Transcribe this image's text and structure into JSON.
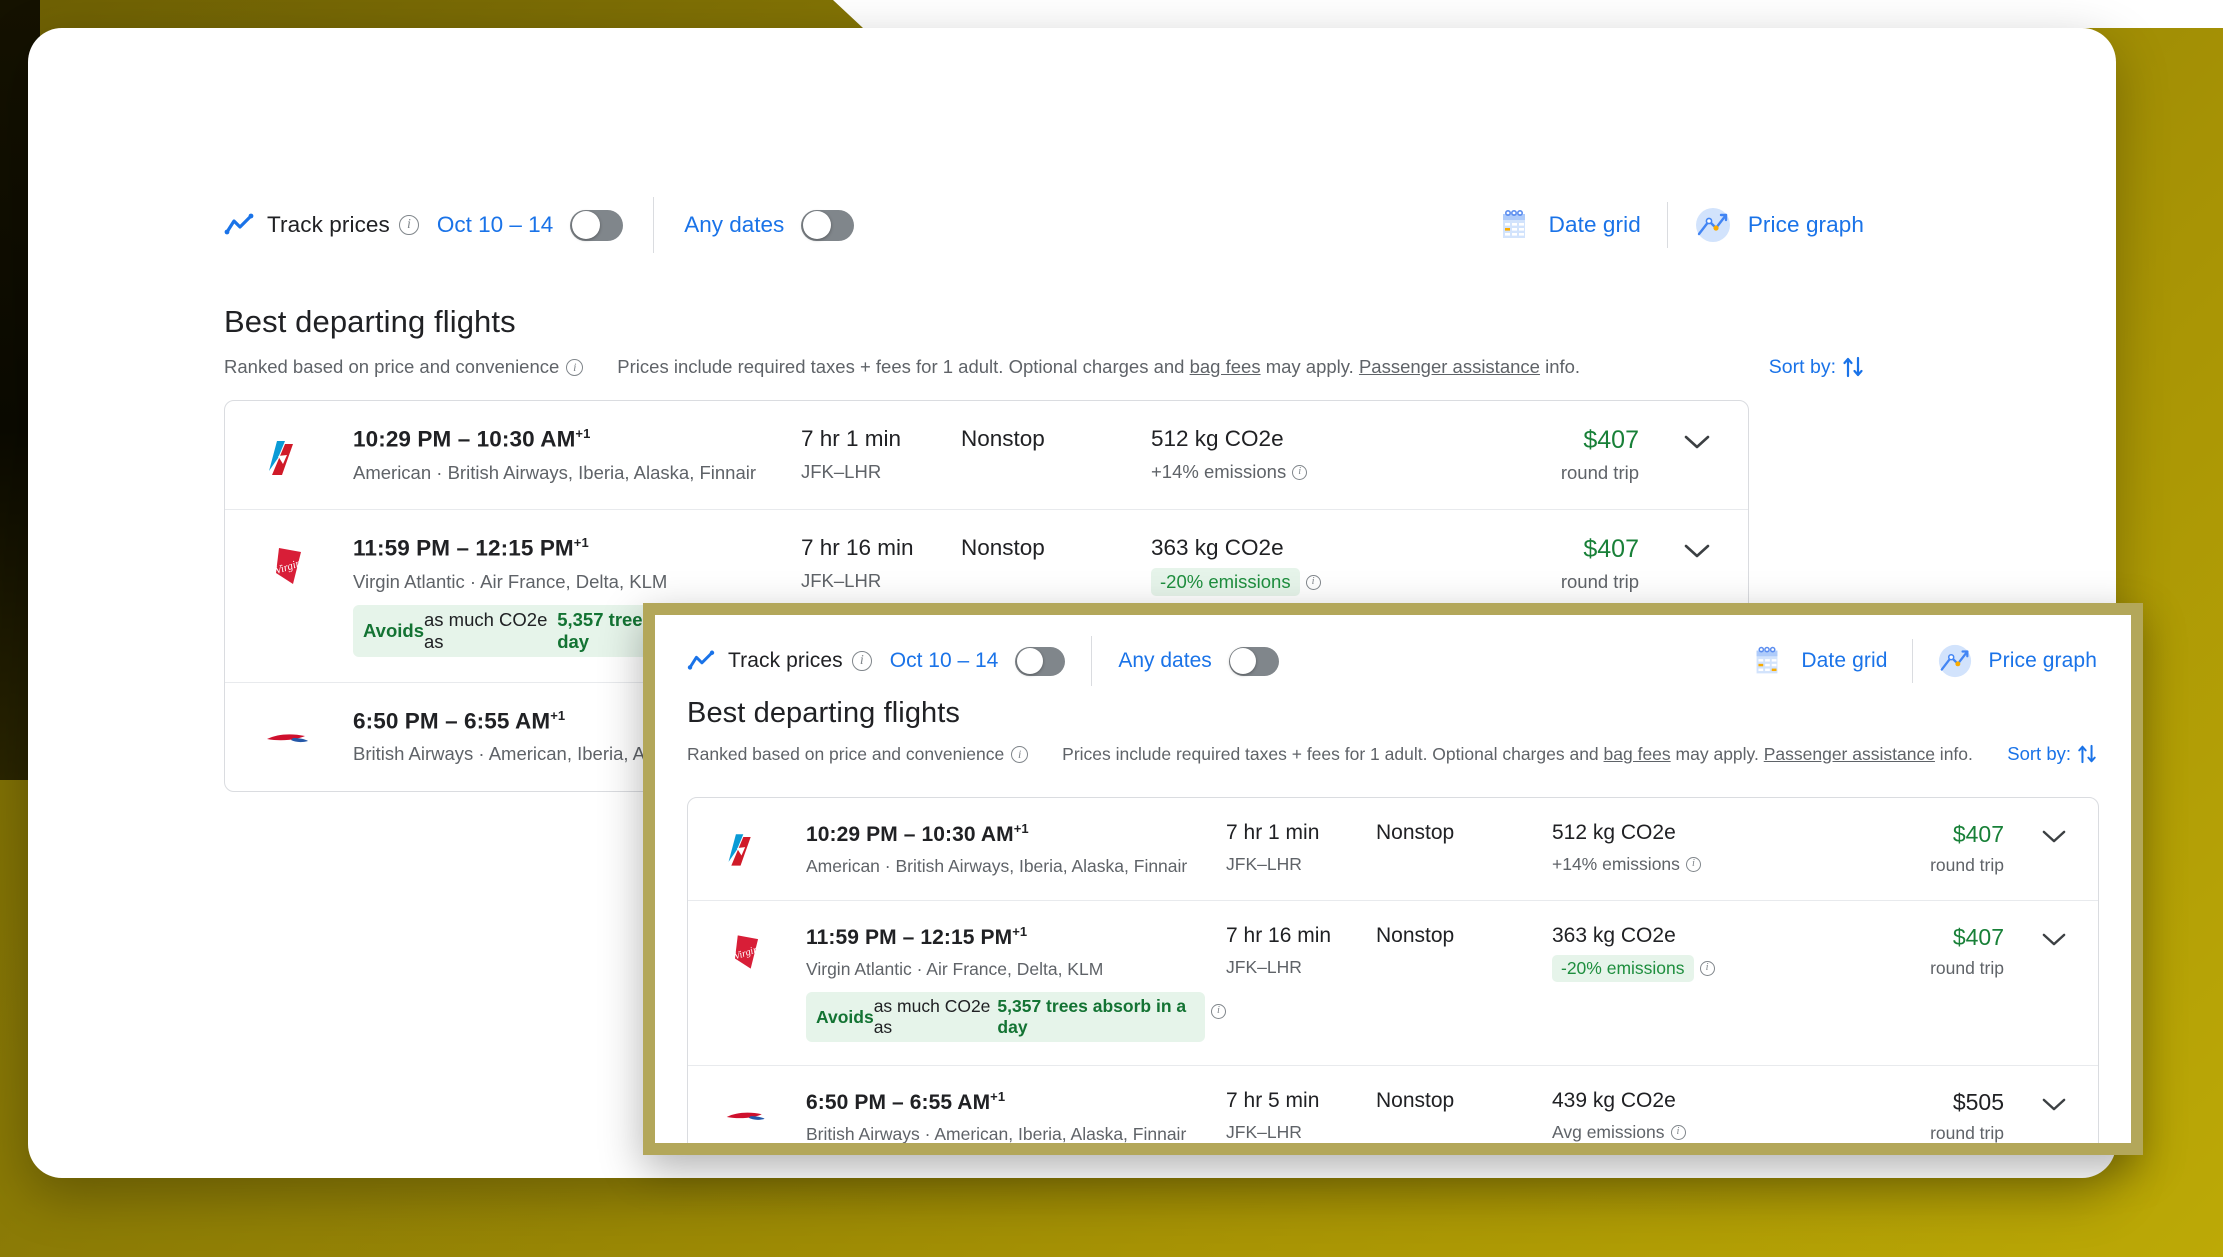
{
  "toolbar": {
    "trend_icon": "trend-line-icon",
    "track_prices_label": "Track prices",
    "track_info_glyph": "i",
    "date_range": "Oct 10 – 14",
    "any_dates_label": "Any dates",
    "date_grid_label": "Date grid",
    "date_grid_icon": "calendar-icon",
    "price_graph_label": "Price graph",
    "price_graph_icon": "price-graph-icon",
    "track_toggle_state": "off",
    "any_dates_toggle_state": "off"
  },
  "section": {
    "title": "Best departing flights",
    "ranked_note": "Ranked based on price and convenience",
    "prices_note_1": "Prices include required taxes + fees for 1 adult. Optional charges and ",
    "bag_fees_link": "bag fees",
    "prices_note_2": " may apply. ",
    "passenger_assistance_link": "Passenger assistance",
    "prices_note_3": " info.",
    "sort_by_label": "Sort by:",
    "sort_icon": "sort-arrows-icon"
  },
  "flights": [
    {
      "logo": "american-airlines-logo",
      "times": "10:29 PM – 10:30 AM",
      "next_day": "+1",
      "airlines": "American · British Airways, Iberia, Alaska, Finnair",
      "duration": "7 hr 1 min",
      "route": "JFK–LHR",
      "stops": "Nonstop",
      "emissions": "512 kg CO2e",
      "emissions_delta": "+14% emissions",
      "emissions_delta_style": "plain",
      "price": "$407",
      "price_style": "green",
      "price_note": "round trip",
      "eco_banner": null,
      "expand_icon": "chevron-down-icon"
    },
    {
      "logo": "virgin-atlantic-logo",
      "times": "11:59 PM – 12:15 PM",
      "next_day": "+1",
      "airlines": "Virgin Atlantic · Air France, Delta, KLM",
      "duration": "7 hr 16 min",
      "route": "JFK–LHR",
      "stops": "Nonstop",
      "emissions": "363 kg CO2e",
      "emissions_delta": "-20% emissions",
      "emissions_delta_style": "pill",
      "price": "$407",
      "price_style": "green",
      "price_note": "round trip",
      "eco_banner": {
        "lead": "Avoids",
        "mid": " as much CO2e as ",
        "strong": "5,357 trees absorb in a day"
      },
      "expand_icon": "chevron-down-icon"
    },
    {
      "logo": "british-airways-logo",
      "times": "6:50 PM – 6:55 AM",
      "next_day": "+1",
      "airlines": "British Airways · American, Iberia, Alaska, Finnair",
      "duration": "7 hr 5 min",
      "route": "JFK–LHR",
      "stops": "Nonstop",
      "emissions": "439 kg CO2e",
      "emissions_delta": "Avg emissions",
      "emissions_delta_style": "plain",
      "price": "$505",
      "price_style": "neutral",
      "price_note": "round trip",
      "eco_banner": null,
      "expand_icon": "chevron-down-icon"
    }
  ],
  "colors": {
    "accent_blue": "#1a73e8",
    "price_green": "#188038",
    "eco_green_bg": "#e6f4ea",
    "eco_green_text": "#137333",
    "text_primary": "#202124",
    "text_secondary": "#5f6368",
    "inset_border": "#b3a75a",
    "page_background": "#8a7a06"
  }
}
